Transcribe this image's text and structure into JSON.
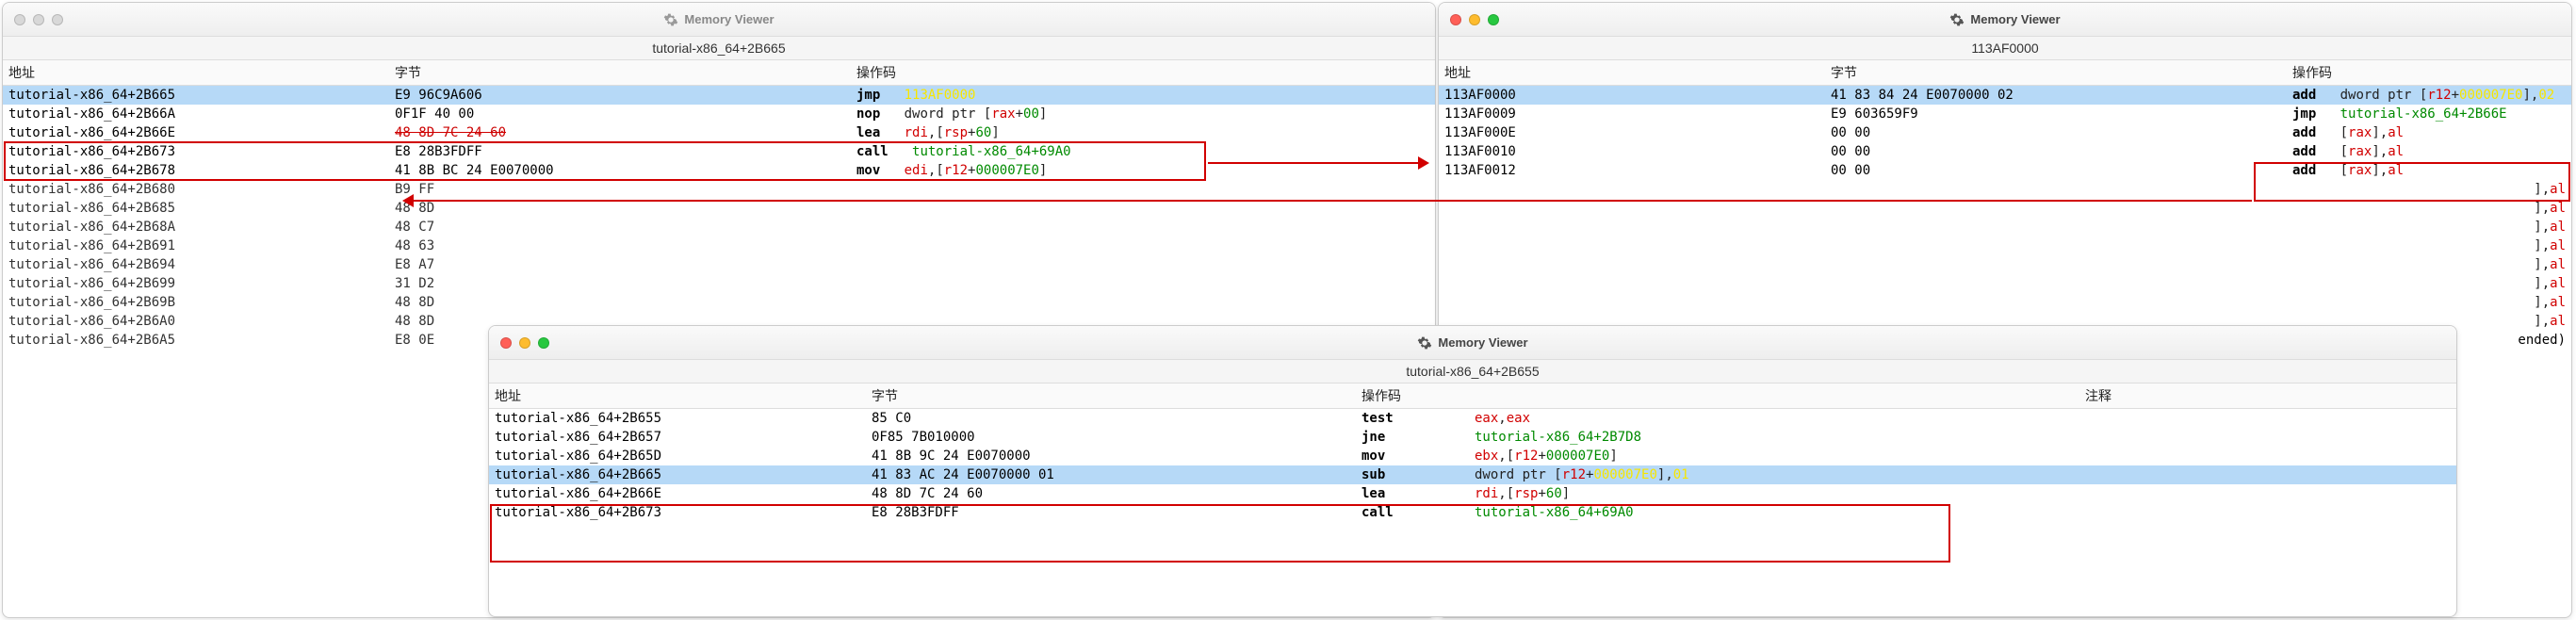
{
  "app_title": "Memory Viewer",
  "gear_color_gray": "#9a9a9a",
  "gear_color_dark": "#555",
  "windowA": {
    "subtitle": "tutorial-x86_64+2B665",
    "headers": {
      "addr": "地址",
      "bytes": "字节",
      "op": "操作码"
    },
    "rows": [
      {
        "addr": "tutorial-x86_64+2B665",
        "bytes": "E9 96C9A606",
        "mn": "jmp",
        "args": [
          [
            "yellow",
            "113AF0000"
          ]
        ],
        "sel": true
      },
      {
        "addr": "tutorial-x86_64+2B66A",
        "bytes": "0F1F 40 00",
        "mn": "nop",
        "args": [
          [
            "dark",
            "dword ptr ["
          ],
          [
            "red",
            "rax"
          ],
          [
            "dark",
            "+"
          ],
          [
            "green",
            "00"
          ],
          [
            "dark",
            "]"
          ]
        ]
      },
      {
        "addr": "tutorial-x86_64+2B66E",
        "bytes": "48 8D 7C 24 60",
        "bytes_struck": true,
        "mn": "lea",
        "args": [
          [
            "red",
            "rdi"
          ],
          [
            "dark",
            ",["
          ],
          [
            "red",
            "rsp"
          ],
          [
            "dark",
            "+"
          ],
          [
            "green",
            "60"
          ],
          [
            "dark",
            "]"
          ]
        ]
      },
      {
        "addr": "tutorial-x86_64+2B673",
        "bytes": "E8 28B3FDFF",
        "mn": "call",
        "args": [
          [
            "green",
            "tutorial-x86_64+69A0"
          ]
        ]
      },
      {
        "addr": "tutorial-x86_64+2B678",
        "bytes": "41 8B BC 24 E0070000",
        "mn": "mov",
        "args": [
          [
            "red",
            "edi"
          ],
          [
            "dark",
            ",["
          ],
          [
            "red",
            "r12"
          ],
          [
            "dark",
            "+"
          ],
          [
            "green",
            "000007E0"
          ],
          [
            "dark",
            "]"
          ]
        ]
      }
    ],
    "rows_trunc": [
      {
        "addr": "tutorial-x86_64+2B680",
        "bytes": "B9 FF"
      },
      {
        "addr": "tutorial-x86_64+2B685",
        "bytes": "48 8D"
      },
      {
        "addr": "tutorial-x86_64+2B68A",
        "bytes": "48 C7"
      },
      {
        "addr": "tutorial-x86_64+2B691",
        "bytes": "48 63"
      },
      {
        "addr": "tutorial-x86_64+2B694",
        "bytes": "E8 A7"
      },
      {
        "addr": "tutorial-x86_64+2B699",
        "bytes": "31 D2"
      },
      {
        "addr": "tutorial-x86_64+2B69B",
        "bytes": "48 8D"
      },
      {
        "addr": "tutorial-x86_64+2B6A0",
        "bytes": "48 8D"
      },
      {
        "addr": "tutorial-x86_64+2B6A5",
        "bytes": "E8 0E"
      }
    ]
  },
  "windowB": {
    "subtitle": "113AF0000",
    "headers": {
      "addr": "地址",
      "bytes": "字节",
      "op": "操作码"
    },
    "rows": [
      {
        "addr": "113AF0000",
        "bytes": "41 83 84 24 E0070000 02",
        "mn": "add",
        "args": [
          [
            "dark",
            "dword ptr ["
          ],
          [
            "red",
            "r12"
          ],
          [
            "dark",
            "+"
          ],
          [
            "yellow",
            "000007E0"
          ],
          [
            "dark",
            "],"
          ],
          [
            "yellow",
            "02"
          ]
        ],
        "sel": true
      },
      {
        "addr": "113AF0009",
        "bytes": "E9 603659F9",
        "mn": "jmp",
        "args": [
          [
            "green",
            "tutorial-x86_64+2B66E"
          ]
        ]
      },
      {
        "addr": "113AF000E",
        "bytes": "00 00",
        "mn": "add",
        "args": [
          [
            "dark",
            "["
          ],
          [
            "red",
            "rax"
          ],
          [
            "dark",
            "],"
          ],
          [
            "red",
            "al"
          ]
        ]
      },
      {
        "addr": "113AF0010",
        "bytes": "00 00",
        "mn": "add",
        "args": [
          [
            "dark",
            "["
          ],
          [
            "red",
            "rax"
          ],
          [
            "dark",
            "],"
          ],
          [
            "red",
            "al"
          ]
        ]
      },
      {
        "addr": "113AF0012",
        "bytes": "00 00",
        "mn": "add",
        "args": [
          [
            "dark",
            "["
          ],
          [
            "red",
            "rax"
          ],
          [
            "dark",
            "],"
          ],
          [
            "red",
            "al"
          ]
        ]
      }
    ],
    "tail": [
      "],al",
      "],al",
      "],al",
      "],al",
      "],al",
      "],al",
      "],al",
      "],al",
      "ended)"
    ]
  },
  "windowC": {
    "subtitle": "tutorial-x86_64+2B655",
    "headers": {
      "addr": "地址",
      "bytes": "字节",
      "op": "操作码",
      "note": "注释"
    },
    "rows": [
      {
        "addr": "tutorial-x86_64+2B655",
        "bytes": "85 C0",
        "mn": "test",
        "args": [
          [
            "red",
            "eax"
          ],
          [
            "dark",
            ","
          ],
          [
            "red",
            "eax"
          ]
        ]
      },
      {
        "addr": "tutorial-x86_64+2B657",
        "bytes": "0F85 7B010000",
        "mn": "jne",
        "args": [
          [
            "green",
            "tutorial-x86_64+2B7D8"
          ]
        ]
      },
      {
        "addr": "tutorial-x86_64+2B65D",
        "bytes": "41 8B 9C 24 E0070000",
        "mn": "mov",
        "args": [
          [
            "red",
            "ebx"
          ],
          [
            "dark",
            ",["
          ],
          [
            "red",
            "r12"
          ],
          [
            "dark",
            "+"
          ],
          [
            "green",
            "000007E0"
          ],
          [
            "dark",
            "]"
          ]
        ]
      },
      {
        "addr": "tutorial-x86_64+2B665",
        "bytes": "41 83 AC 24 E0070000 01",
        "mn": "sub",
        "args": [
          [
            "dark",
            "dword ptr ["
          ],
          [
            "red",
            "r12"
          ],
          [
            "dark",
            "+"
          ],
          [
            "yellow",
            "000007E0"
          ],
          [
            "dark",
            "],"
          ],
          [
            "yellow",
            "01"
          ]
        ],
        "sel": true
      },
      {
        "addr": "tutorial-x86_64+2B66E",
        "bytes": "48 8D 7C 24 60",
        "mn": "lea",
        "args": [
          [
            "red",
            "rdi"
          ],
          [
            "dark",
            ",["
          ],
          [
            "red",
            "rsp"
          ],
          [
            "dark",
            "+"
          ],
          [
            "green",
            "60"
          ],
          [
            "dark",
            "]"
          ]
        ]
      },
      {
        "addr": "tutorial-x86_64+2B673",
        "bytes": "E8 28B3FDFF",
        "mn": "call",
        "args": [
          [
            "green",
            "tutorial-x86_64+69A0"
          ]
        ]
      }
    ]
  }
}
